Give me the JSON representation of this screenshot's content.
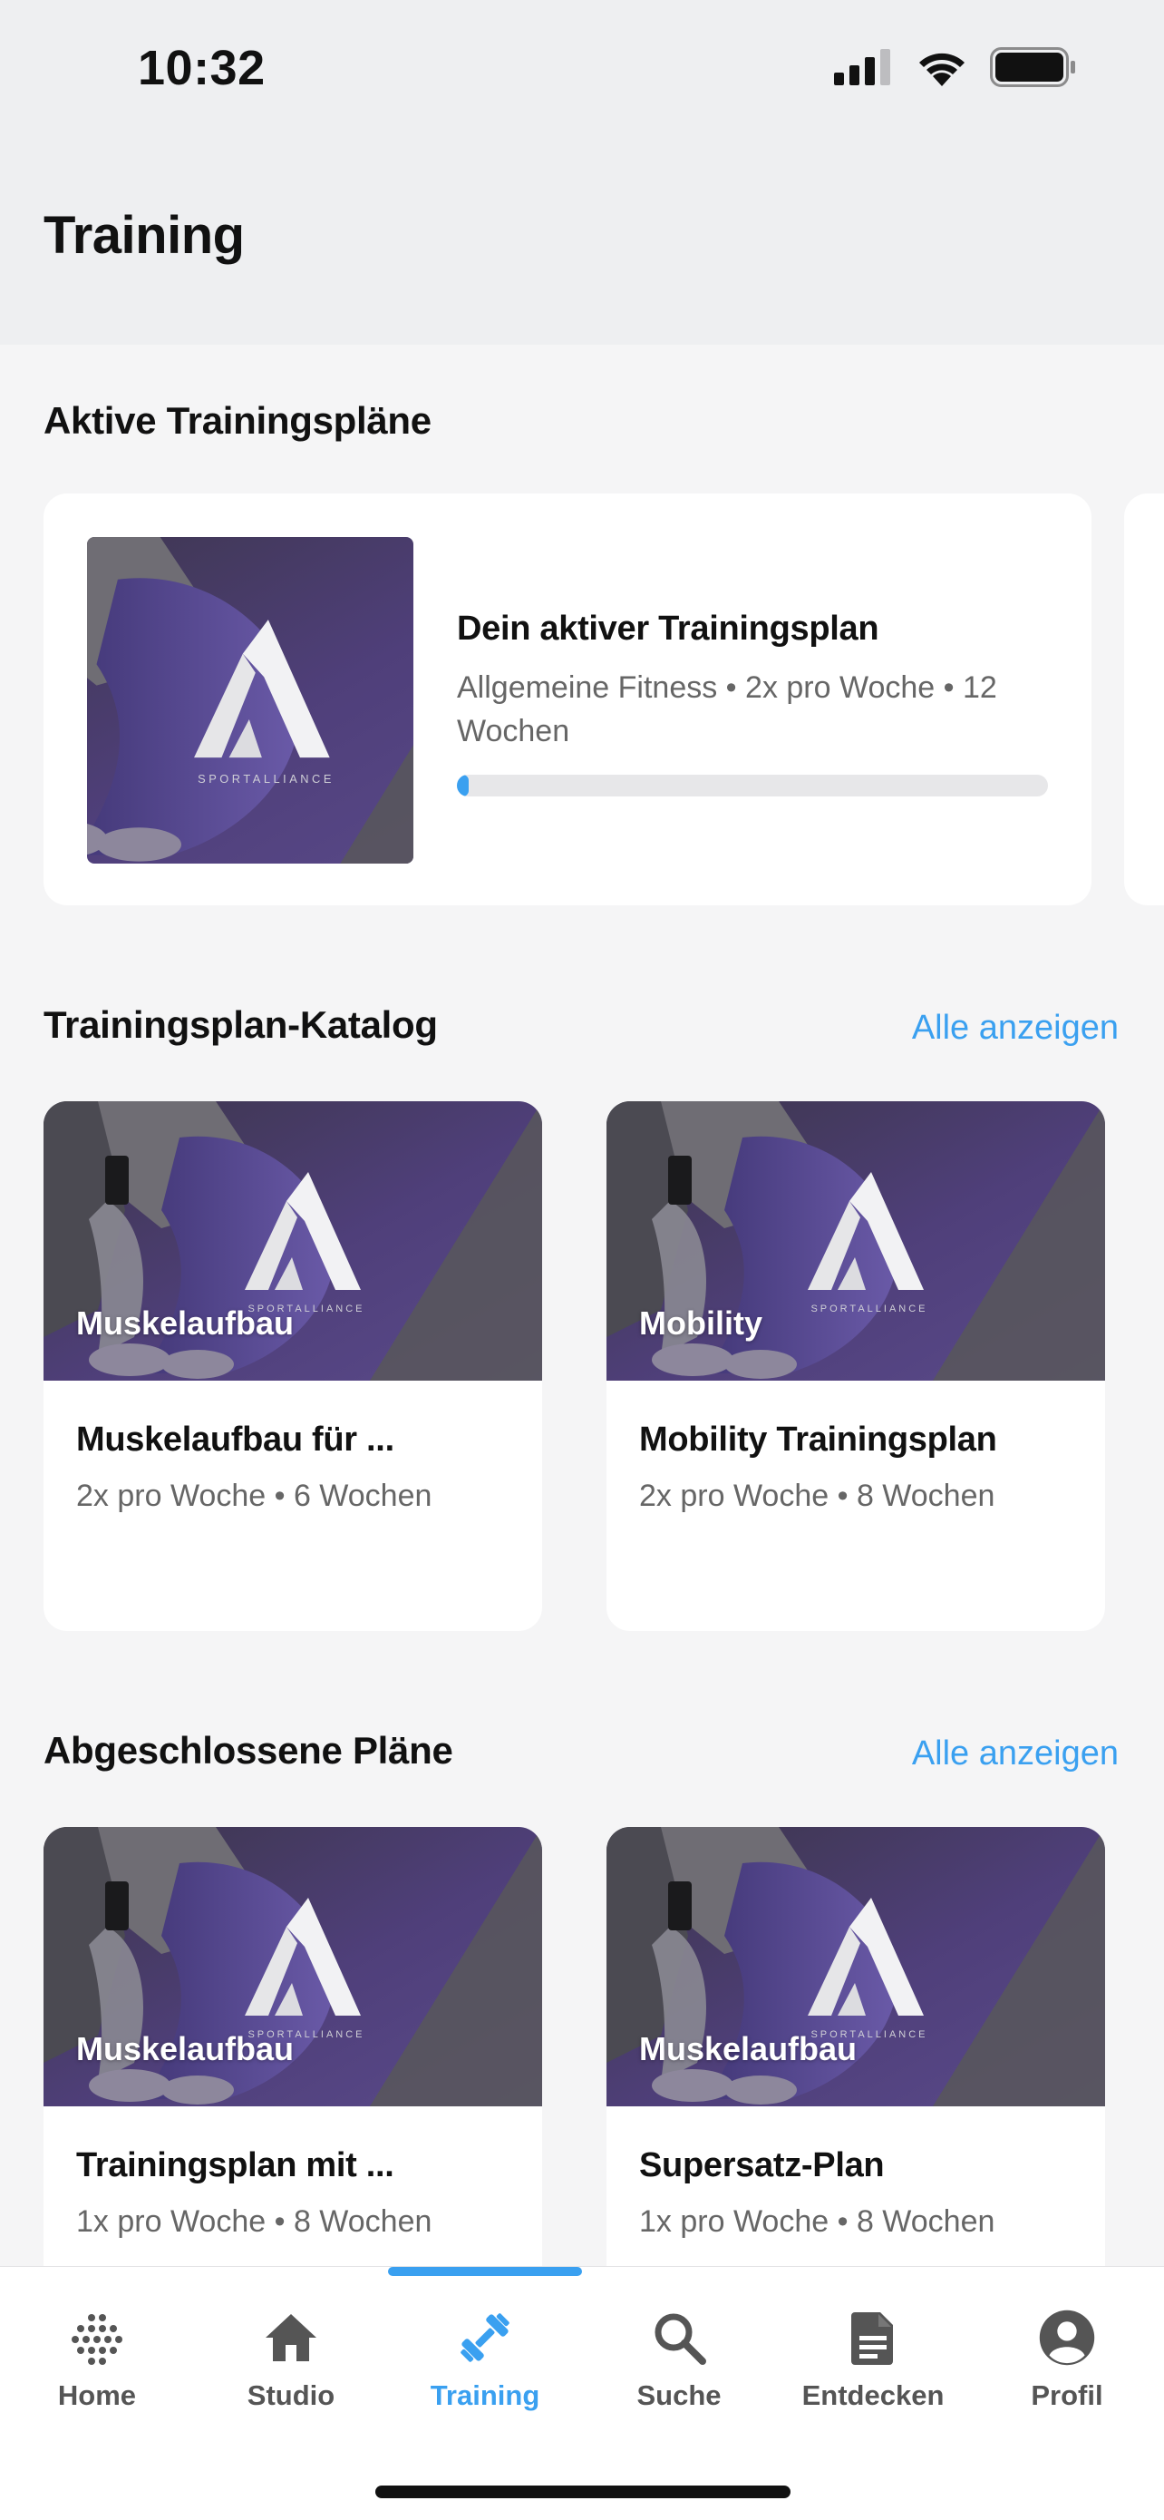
{
  "status_bar": {
    "time": "10:32"
  },
  "header": {
    "title": "Training"
  },
  "active_plans": {
    "section_title": "Aktive Trainingspläne",
    "card": {
      "title": "Dein aktiver Trainingsplan",
      "meta": "Allgemeine Fitness • 2x pro Woche • 12 Wochen",
      "progress_percent": 2,
      "image_logo_text": "SPORTALLIANCE"
    }
  },
  "catalog": {
    "section_title": "Trainingsplan-Katalog",
    "see_all": "Alle anzeigen",
    "cards": [
      {
        "tag": "Muskelaufbau",
        "title": "Muskelaufbau für ...",
        "meta": "2x pro Woche • 6 Wochen"
      },
      {
        "tag": "Mobility",
        "title": "Mobility Trainingsplan",
        "meta": "2x pro Woche • 8 Wochen"
      }
    ]
  },
  "completed": {
    "section_title": "Abgeschlossene Pläne",
    "see_all": "Alle anzeigen",
    "cards": [
      {
        "tag": "Muskelaufbau",
        "title": "Trainingsplan mit ...",
        "meta": "1x pro Woche • 8 Wochen"
      },
      {
        "tag": "Muskelaufbau",
        "title": "Supersatz-Plan",
        "meta": "1x pro Woche • 8 Wochen"
      }
    ]
  },
  "tabbar": {
    "active": "Training",
    "items": [
      {
        "label": "Home",
        "icon": "dots-grid-icon"
      },
      {
        "label": "Studio",
        "icon": "house-icon"
      },
      {
        "label": "Training",
        "icon": "dumbbell-icon"
      },
      {
        "label": "Suche",
        "icon": "search-icon"
      },
      {
        "label": "Entdecken",
        "icon": "document-icon"
      },
      {
        "label": "Profil",
        "icon": "profile-icon"
      }
    ]
  },
  "colors": {
    "accent": "#3aa0f0",
    "header_bg": "#eeeff1",
    "page_bg": "#f5f5f6"
  }
}
